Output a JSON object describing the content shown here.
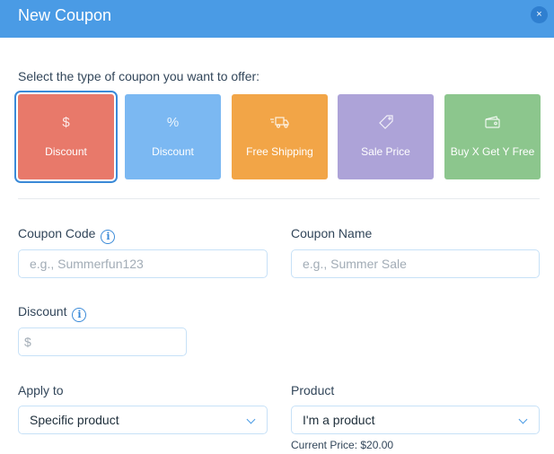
{
  "header": {
    "title": "New Coupon",
    "close_glyph": "×",
    "background": "#4a9be5"
  },
  "coupon_types": {
    "prompt": "Select the type of coupon you want to offer:",
    "cards": [
      {
        "id": "fixed-discount",
        "icon": "dollar-icon",
        "glyph": "$",
        "label": "Discount",
        "color": "#e8796a",
        "selected": true
      },
      {
        "id": "percent-discount",
        "icon": "percent-icon",
        "glyph": "%",
        "label": "Discount",
        "color": "#7bb8f2",
        "selected": false
      },
      {
        "id": "free-shipping",
        "icon": "truck-icon",
        "label": "Free Shipping",
        "color": "#f2a547",
        "selected": false
      },
      {
        "id": "sale-price",
        "icon": "tag-icon",
        "label": "Sale Price",
        "color": "#ada3d8",
        "selected": false
      },
      {
        "id": "buy-x-get-y",
        "icon": "wallet-icon",
        "label": "Buy X Get Y Free",
        "color": "#8cc68d",
        "selected": false
      }
    ]
  },
  "form": {
    "coupon_code": {
      "label": "Coupon Code",
      "placeholder": "e.g., Summerfun123",
      "value": ""
    },
    "coupon_name": {
      "label": "Coupon Name",
      "placeholder": "e.g., Summer Sale",
      "value": ""
    },
    "discount": {
      "label": "Discount",
      "placeholder": "$",
      "value": ""
    },
    "apply_to": {
      "label": "Apply to",
      "selected": "Specific product"
    },
    "product": {
      "label": "Product",
      "selected": "I'm a product",
      "helper": "Current Price: $20.00"
    }
  },
  "info_glyph": "i"
}
